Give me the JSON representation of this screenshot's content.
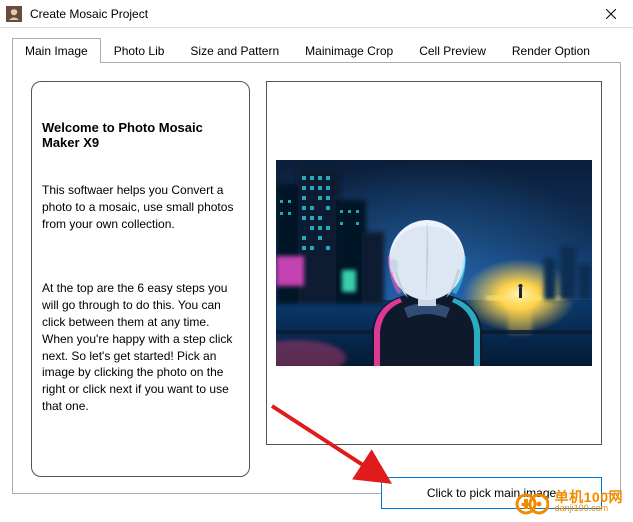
{
  "window": {
    "title": "Create Mosaic Project",
    "close_tooltip": "Close"
  },
  "tabs": [
    {
      "label": "Main Image",
      "active": true
    },
    {
      "label": "Photo Lib",
      "active": false
    },
    {
      "label": "Size and Pattern",
      "active": false
    },
    {
      "label": "Mainimage Crop",
      "active": false
    },
    {
      "label": "Cell Preview",
      "active": false
    },
    {
      "label": "Render Option",
      "active": false
    }
  ],
  "info": {
    "heading": "Welcome to Photo Mosaic Maker X9",
    "para1": "This softwaer helps you Convert a photo to a mosaic, use small photos from your own collection.",
    "para2": "At the top are the 6 easy steps you will go through to do this. You can click between them at any time. When you're happy with a step click next. So let's get started! Pick an image by clicking the photo on the right or click next if you want to use that one."
  },
  "preview": {
    "alt": "Anime-style character with short white hair viewed from behind, standing before a blurred neon city skyline at night with a bright yellow light on the horizon"
  },
  "buttons": {
    "pick_main_image": "Click to pick main image"
  },
  "watermark": {
    "main": "单机100网",
    "sub": "danji100.com"
  },
  "colors": {
    "accent": "#0078d7",
    "annotation": "#e11b1b",
    "watermark": "#f08c00"
  }
}
